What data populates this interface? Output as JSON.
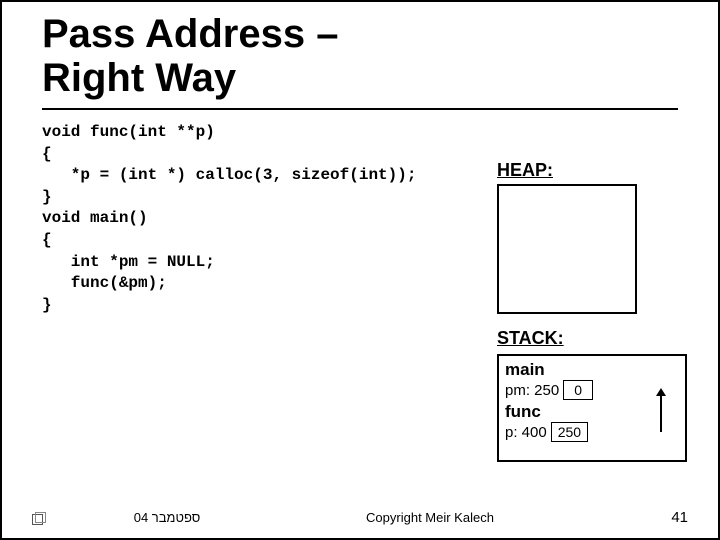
{
  "title_line1": "Pass Address –",
  "title_line2": "Right Way",
  "code": {
    "l0": "void func(int **p)",
    "l1": "{",
    "l2": "   *p = (int *) calloc(3, sizeof(int));",
    "l3": "}",
    "l4": "void main()",
    "l5": "{",
    "l6": "   int *pm = NULL;",
    "l7": "   func(&pm);",
    "l8": "}"
  },
  "heap_label": "HEAP:",
  "stack_label": "STACK:",
  "stack": {
    "main": {
      "title": "main",
      "var_label": "pm: 250",
      "var_box": "0"
    },
    "func": {
      "title": "func",
      "var_label": "p: 400",
      "var_box": "250"
    }
  },
  "footer": {
    "left": "ספטמבר 04",
    "center": "Copyright Meir Kalech",
    "page": "41"
  }
}
